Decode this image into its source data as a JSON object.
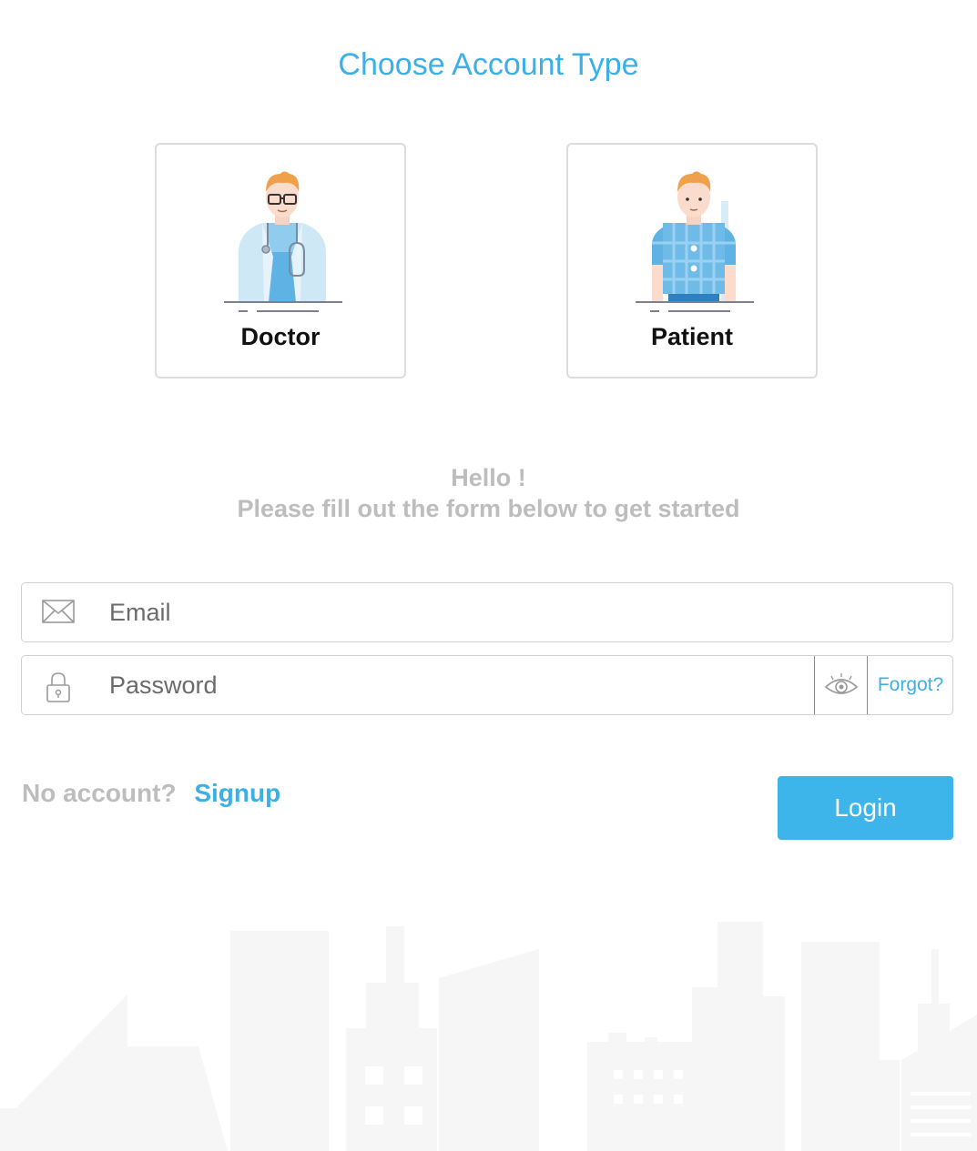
{
  "page": {
    "title": "Choose Account Type"
  },
  "account_types": [
    {
      "label": "Doctor",
      "icon": "doctor-avatar-icon"
    },
    {
      "label": "Patient",
      "icon": "patient-avatar-icon"
    }
  ],
  "greeting": {
    "line1": "Hello !",
    "line2": "Please fill out the form below to get started"
  },
  "form": {
    "email": {
      "placeholder": "Email",
      "value": "",
      "icon": "envelope-icon"
    },
    "password": {
      "placeholder": "Password",
      "value": "",
      "icon": "lock-icon",
      "toggle_icon": "eye-icon"
    },
    "forgot_label": "Forgot?"
  },
  "footer": {
    "no_account_text": "No account?",
    "signup_label": "Signup",
    "login_label": "Login"
  },
  "colors": {
    "accent": "#3cafe6",
    "button": "#3db5ea",
    "muted_text": "#bdbdbd",
    "border": "#d0d0d0",
    "skyline": "#f6f6f6"
  }
}
